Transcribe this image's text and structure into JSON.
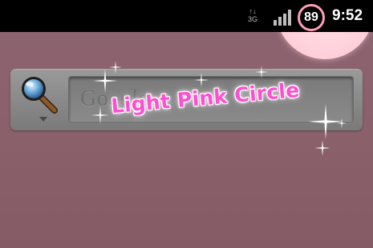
{
  "status_bar": {
    "network_type": "3G",
    "network_arrows": "↑↓",
    "battery_level": "89",
    "clock": "9:52",
    "icons": [
      "data-activity-icon",
      "signal-strength-icon",
      "battery-ring-icon"
    ]
  },
  "theme": {
    "title": "Light Pink Circle",
    "accent_color": "#ff4fd0",
    "circle_color": "#ffd3db",
    "wallpaper_color": "#8a606b"
  },
  "search_widget": {
    "placeholder": "Google",
    "search_icon": "magnifier-icon",
    "dropdown_icon": "triangle-down-icon"
  }
}
